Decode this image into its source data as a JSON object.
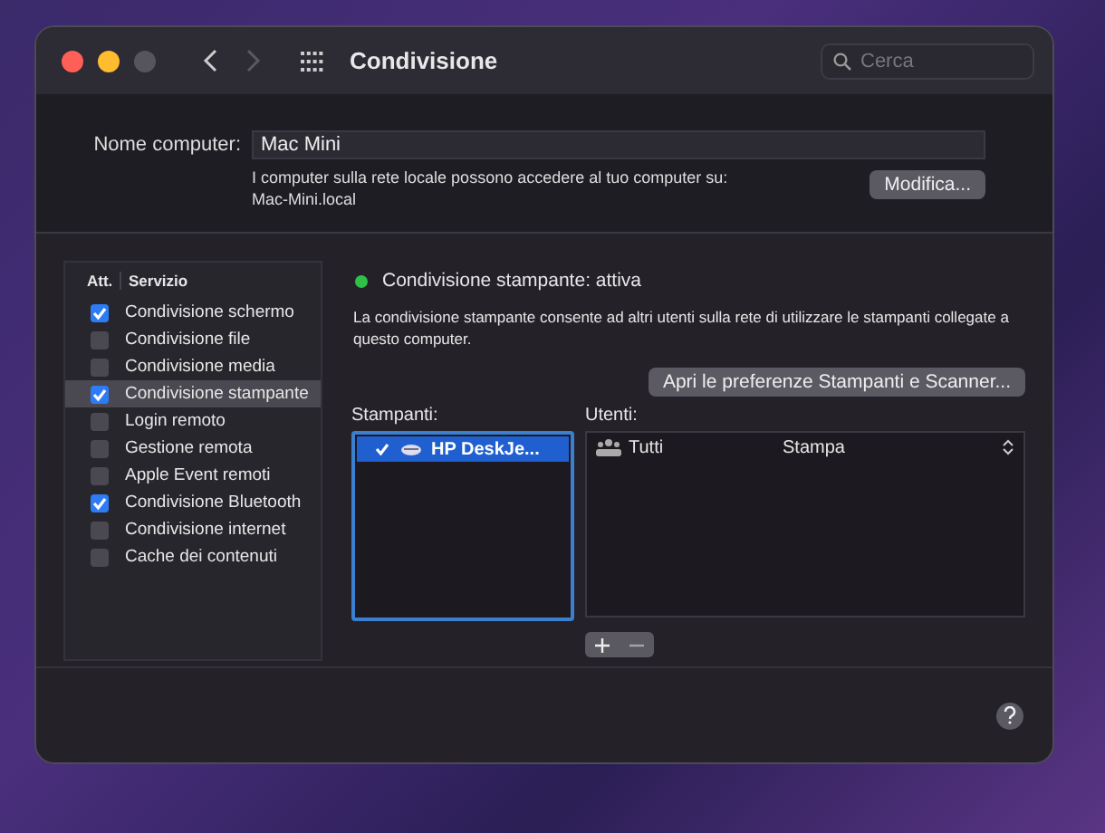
{
  "window": {
    "title": "Condivisione"
  },
  "search": {
    "placeholder": "Cerca"
  },
  "computer_name": {
    "label": "Nome computer:",
    "value": "Mac Mini",
    "note": "I computer sulla rete locale possono accedere al tuo computer su:",
    "address": "Mac-Mini.local",
    "button": "Modifica..."
  },
  "services": {
    "columns": [
      "Att.",
      "Servizio"
    ],
    "items": [
      {
        "name": "Condivisione schermo",
        "checked": true,
        "selected": false
      },
      {
        "name": "Condivisione file",
        "checked": false,
        "selected": false
      },
      {
        "name": "Condivisione media",
        "checked": false,
        "selected": false
      },
      {
        "name": "Condivisione stampante",
        "checked": true,
        "selected": true
      },
      {
        "name": "Login remoto",
        "checked": false,
        "selected": false
      },
      {
        "name": "Gestione remota",
        "checked": false,
        "selected": false
      },
      {
        "name": "Apple Event remoti",
        "checked": false,
        "selected": false
      },
      {
        "name": "Condivisione Bluetooth",
        "checked": true,
        "selected": false
      },
      {
        "name": "Condivisione internet",
        "checked": false,
        "selected": false
      },
      {
        "name": "Cache dei contenuti",
        "checked": false,
        "selected": false
      }
    ]
  },
  "detail": {
    "status": {
      "text": "Condivisione stampante: attiva",
      "color": "#30c048"
    },
    "description": "La condivisione stampante consente ad altri utenti sulla rete di utilizzare le stampanti collegate a questo computer.",
    "open_button": "Apri le preferenze Stampanti e Scanner...",
    "printers": {
      "label": "Stampanti:",
      "items": [
        {
          "name": "HP DeskJe...",
          "checked": true,
          "selected": true
        }
      ]
    },
    "users": {
      "label": "Utenti:",
      "items": [
        {
          "name": "Tutti",
          "permission": "Stampa"
        }
      ]
    },
    "user_buttons": [
      {
        "kind": "add",
        "disabled": false
      },
      {
        "kind": "remove",
        "disabled": true
      }
    ]
  }
}
